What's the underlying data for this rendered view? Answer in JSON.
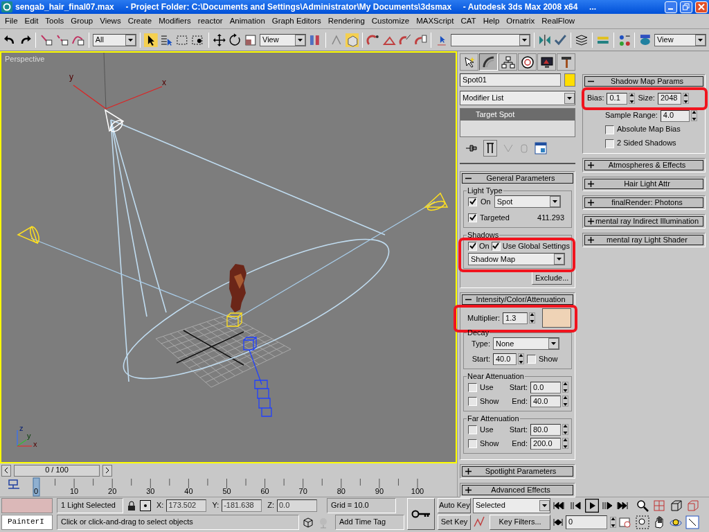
{
  "window": {
    "title": "sengab_hair_final07.max     - Project Folder: C:\\Documents and Settings\\Administrator\\My Documents\\3dsmax     - Autodesk 3ds Max 2008 x64     ..."
  },
  "menu": [
    "File",
    "Edit",
    "Tools",
    "Group",
    "Views",
    "Create",
    "Modifiers",
    "reactor",
    "Animation",
    "Graph Editors",
    "Rendering",
    "Customize",
    "MAXScript",
    "CAT",
    "Help",
    "Ornatrix",
    "RealFlow"
  ],
  "toolbar": {
    "selection_filter": "All",
    "reference_coord": "View",
    "viewport_view": "View"
  },
  "viewport": {
    "label": "Perspective",
    "light_axes": [
      "y",
      "x"
    ],
    "gizmo_axes": [
      "z",
      "y",
      "x"
    ]
  },
  "command_panel": {
    "tabs": [
      {
        "selected": false
      },
      {
        "selected": true
      },
      {
        "selected": false
      },
      {
        "selected": false
      },
      {
        "selected": false
      },
      {
        "selected": false
      }
    ],
    "object": {
      "name": "Spot01",
      "color": "#ffde00"
    },
    "modifier_list": "Modifier List",
    "stack": [
      {
        "label": "Target Spot",
        "selected": true
      }
    ],
    "left_rollouts": [
      {
        "kind": "general",
        "title": "General Parameters",
        "expanded": true,
        "light_type_label": "Light Type",
        "on": {
          "label": "On",
          "checked": true
        },
        "type": "Spot",
        "targeted": {
          "label": "Targeted",
          "checked": true
        },
        "distance": "411.293",
        "shadows": {
          "label": "Shadows",
          "highlighted": true,
          "on": {
            "label": "On",
            "checked": true
          },
          "use_global": {
            "label": "Use Global Settings",
            "checked": true
          },
          "type": "Shadow Map"
        },
        "exclude": "Exclude..."
      },
      {
        "kind": "intensity",
        "title": "Intensity/Color/Attenuation",
        "expanded": true,
        "multiplier": {
          "label": "Multiplier:",
          "value": "1.3",
          "color": "#efd3b6",
          "highlighted": true
        },
        "decay": {
          "label": "Decay",
          "type_label": "Type:",
          "type": "None",
          "start_label": "Start:",
          "start": "40.0",
          "show": {
            "label": "Show",
            "checked": false
          }
        },
        "near": {
          "label": "Near Attenuation",
          "use": {
            "label": "Use",
            "checked": false
          },
          "show": {
            "label": "Show",
            "checked": false
          },
          "start_label": "Start:",
          "start": "0.0",
          "end_label": "End:",
          "end": "40.0"
        },
        "far": {
          "label": "Far Attenuation",
          "use": {
            "label": "Use",
            "checked": false
          },
          "show": {
            "label": "Show",
            "checked": false
          },
          "start_label": "Start:",
          "start": "80.0",
          "end_label": "End:",
          "end": "200.0"
        }
      },
      {
        "title": "Spotlight Parameters",
        "expanded": false
      },
      {
        "title": "Advanced Effects",
        "expanded": false
      }
    ],
    "right_rollouts": [
      {
        "kind": "shadow_map",
        "title": "Shadow Map Params",
        "expanded": true,
        "highlighted": true,
        "bias_label": "Bias:",
        "bias": "0.1",
        "size_label": "Size:",
        "size": "2048",
        "sample_range_label": "Sample Range:",
        "sample_range": "4.0",
        "absolute": {
          "label": "Absolute Map Bias",
          "checked": false
        },
        "two_sided": {
          "label": "2 Sided Shadows",
          "checked": false
        }
      },
      {
        "title": "Atmospheres & Effects",
        "expanded": false
      },
      {
        "title": "Hair Light Attr",
        "expanded": false
      },
      {
        "title": "finalRender: Photons",
        "expanded": false
      },
      {
        "title": "mental ray Indirect Illumination",
        "expanded": false
      },
      {
        "title": "mental ray Light Shader",
        "expanded": false
      }
    ]
  },
  "timeline": {
    "slider": "0 / 100",
    "level": 0,
    "frames": [
      "0",
      "10",
      "20",
      "30",
      "40",
      "50",
      "60",
      "70",
      "80",
      "90",
      "100"
    ]
  },
  "status_bar": {
    "listener": "PainterI",
    "selection": "1 Light Selected",
    "x": {
      "label": "X:",
      "value": "173.502"
    },
    "y": {
      "label": "Y:",
      "value": "-181.638"
    },
    "z": {
      "label": "Z:",
      "value": "0.0"
    },
    "grid": "Grid = 10.0",
    "time_tag": "Add Time Tag",
    "prompt": "Click or click-and-drag to select objects",
    "auto_key": "Auto Key",
    "key_mode": "Selected",
    "set_key": "Set Key",
    "key_filters": "Key Filters...",
    "frame": "0"
  }
}
